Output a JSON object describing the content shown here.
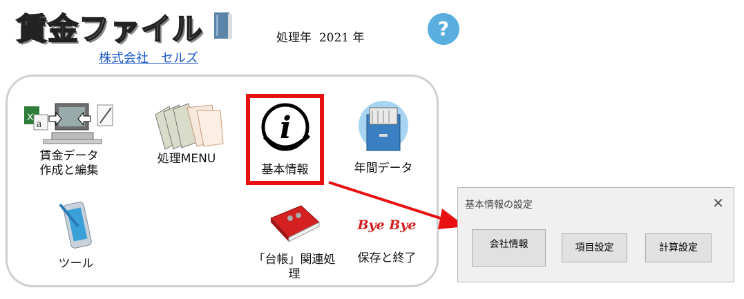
{
  "header": {
    "app_title": "賃金ファイル",
    "year_label": "処理年",
    "year_value": "2021",
    "year_unit": "年",
    "company_name": "株式会社　セルズ",
    "help_label": "?"
  },
  "menu": {
    "items": [
      {
        "id": "wage-data",
        "line1": "賃金データ",
        "line2": "作成と編集",
        "icon": "computer-transfer-icon"
      },
      {
        "id": "process-menu",
        "line1": "処理MENU",
        "line2": "",
        "icon": "documents-icon"
      },
      {
        "id": "basic-info",
        "line1": "基本情報",
        "line2": "",
        "icon": "info-icon"
      },
      {
        "id": "annual-data",
        "line1": "年間データ",
        "line2": "",
        "icon": "file-cabinet-icon"
      },
      {
        "id": "tools",
        "line1": "ツール",
        "line2": "",
        "icon": "smartphone-icon"
      },
      {
        "id": "ledger",
        "line1": "「台帳」関連処理",
        "line2": "",
        "icon": "binder-icon"
      },
      {
        "id": "save-exit",
        "line1": "保存と終了",
        "line2": "",
        "icon": "bye-bye-icon",
        "icon_text": "Bye Bye"
      }
    ]
  },
  "dialog": {
    "title": "基本情報の設定",
    "close_label": "✕",
    "buttons": [
      "会社情報",
      "項目設定",
      "計算設定"
    ]
  },
  "colors": {
    "highlight": "#e81010",
    "link": "#1a56c9",
    "help": "#5aaedf"
  }
}
